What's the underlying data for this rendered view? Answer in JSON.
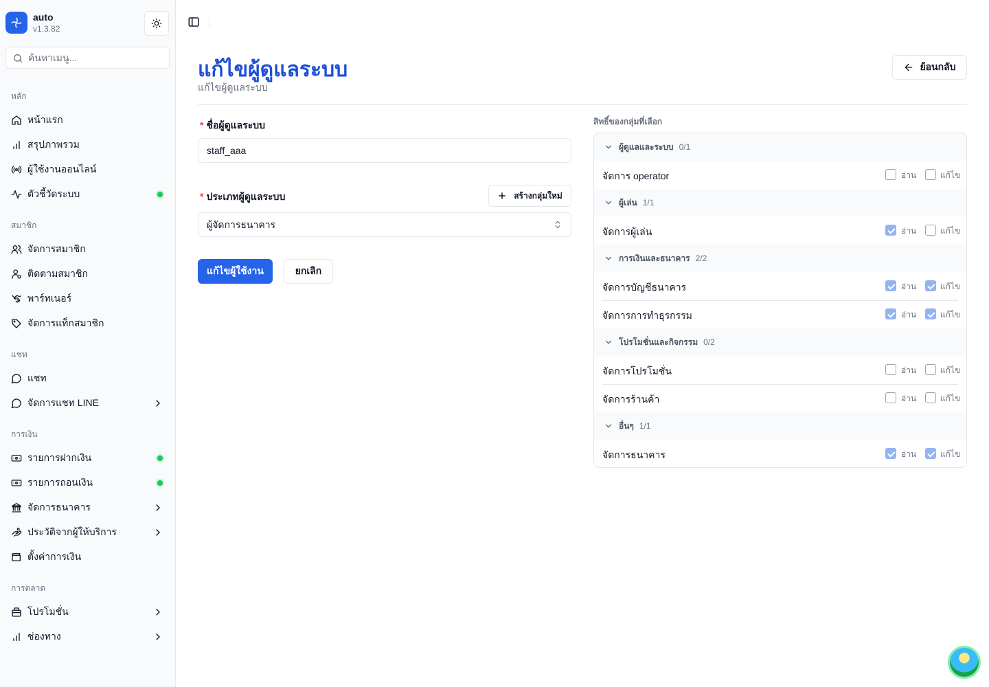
{
  "app": {
    "name": "auto",
    "version": "v1.3.82"
  },
  "search": {
    "placeholder": "ค้นหาเมนู..."
  },
  "sidebar": {
    "groups": [
      {
        "label": "หลัก",
        "items": [
          {
            "label": "หน้าแรก",
            "icon": "home-icon"
          },
          {
            "label": "สรุปภาพรวม",
            "icon": "bar-chart-icon"
          },
          {
            "label": "ผู้ใช้งานออนไลน์",
            "icon": "radio-icon"
          },
          {
            "label": "ตัวชี้วัดระบบ",
            "icon": "activity-icon",
            "status": "online"
          }
        ]
      },
      {
        "label": "สมาชิก",
        "items": [
          {
            "label": "จัดการสมาชิก",
            "icon": "users-icon"
          },
          {
            "label": "ติดตามสมาชิก",
            "icon": "user-search-icon"
          },
          {
            "label": "พาร์ทเนอร์",
            "icon": "handshake-icon"
          },
          {
            "label": "จัดการแท็กสมาชิก",
            "icon": "tag-icon"
          }
        ]
      },
      {
        "label": "แชท",
        "items": [
          {
            "label": "แชท",
            "icon": "message-icon"
          },
          {
            "label": "จัดการแชท LINE",
            "icon": "message-icon",
            "expandable": true
          }
        ]
      },
      {
        "label": "การเงิน",
        "items": [
          {
            "label": "รายการฝากเงิน",
            "icon": "deposit-icon",
            "status": "online"
          },
          {
            "label": "รายการถอนเงิน",
            "icon": "withdraw-icon",
            "status": "online"
          },
          {
            "label": "จัดการธนาคาร",
            "icon": "bank-icon",
            "expandable": true
          },
          {
            "label": "ประวัติจากผู้ให้บริการ",
            "icon": "history-icon",
            "expandable": true
          },
          {
            "label": "ตั้งค่าการเงิน",
            "icon": "wallet-icon"
          }
        ]
      },
      {
        "label": "การตลาด",
        "items": [
          {
            "label": "โปรโมชั่น",
            "icon": "gift-icon",
            "expandable": true
          },
          {
            "label": "ช่องทาง",
            "icon": "bar-chart-icon",
            "expandable": true
          }
        ]
      }
    ]
  },
  "page": {
    "title": "แก้ไขผู้ดูแลระบบ",
    "subtitle": "แก้ไขผู้ดูแลระบบ",
    "back_label": "ย้อนกลับ"
  },
  "form": {
    "username_label": "ชื่อผู้ดูแลระบบ",
    "username_value": "staff_aaa",
    "type_label": "ประเภทผู้ดูแลระบบ",
    "type_value": "ผู้จัดการธนาคาร",
    "new_group_label": "สร้างกลุ่มใหม่",
    "submit_label": "แก้ไขผู้ใช้งาน",
    "cancel_label": "ยกเลิก",
    "required_mark": "*"
  },
  "permissions": {
    "heading": "สิทธิ์ของกลุ่มที่เลือก",
    "read_label": "อ่าน",
    "edit_label": "แก้ไข",
    "groups": [
      {
        "name": "ผู้ดูแลและระบบ",
        "count": "0/1",
        "rows": [
          {
            "name": "จัดการ operator",
            "read": false,
            "edit": false
          }
        ]
      },
      {
        "name": "ผู้เล่น",
        "count": "1/1",
        "rows": [
          {
            "name": "จัดการผู้เล่น",
            "read": true,
            "edit": false
          }
        ]
      },
      {
        "name": "การเงินและธนาคาร",
        "count": "2/2",
        "rows": [
          {
            "name": "จัดการบัญชีธนาคาร",
            "read": true,
            "edit": true
          },
          {
            "name": "จัดการการทำธุรกรรม",
            "read": true,
            "edit": true
          }
        ]
      },
      {
        "name": "โปรโมชั่นและกิจกรรม",
        "count": "0/2",
        "rows": [
          {
            "name": "จัดการโปรโมชั่น",
            "read": false,
            "edit": false
          },
          {
            "name": "จัดการร้านค้า",
            "read": false,
            "edit": false
          }
        ]
      },
      {
        "name": "อื่นๆ",
        "count": "1/1",
        "rows": [
          {
            "name": "จัดการธนาคาร",
            "read": true,
            "edit": true
          }
        ]
      }
    ]
  },
  "colors": {
    "accent": "#2563eb",
    "title": "#1d4ed8",
    "status_online": "#22c55e",
    "required": "#ef4444"
  }
}
